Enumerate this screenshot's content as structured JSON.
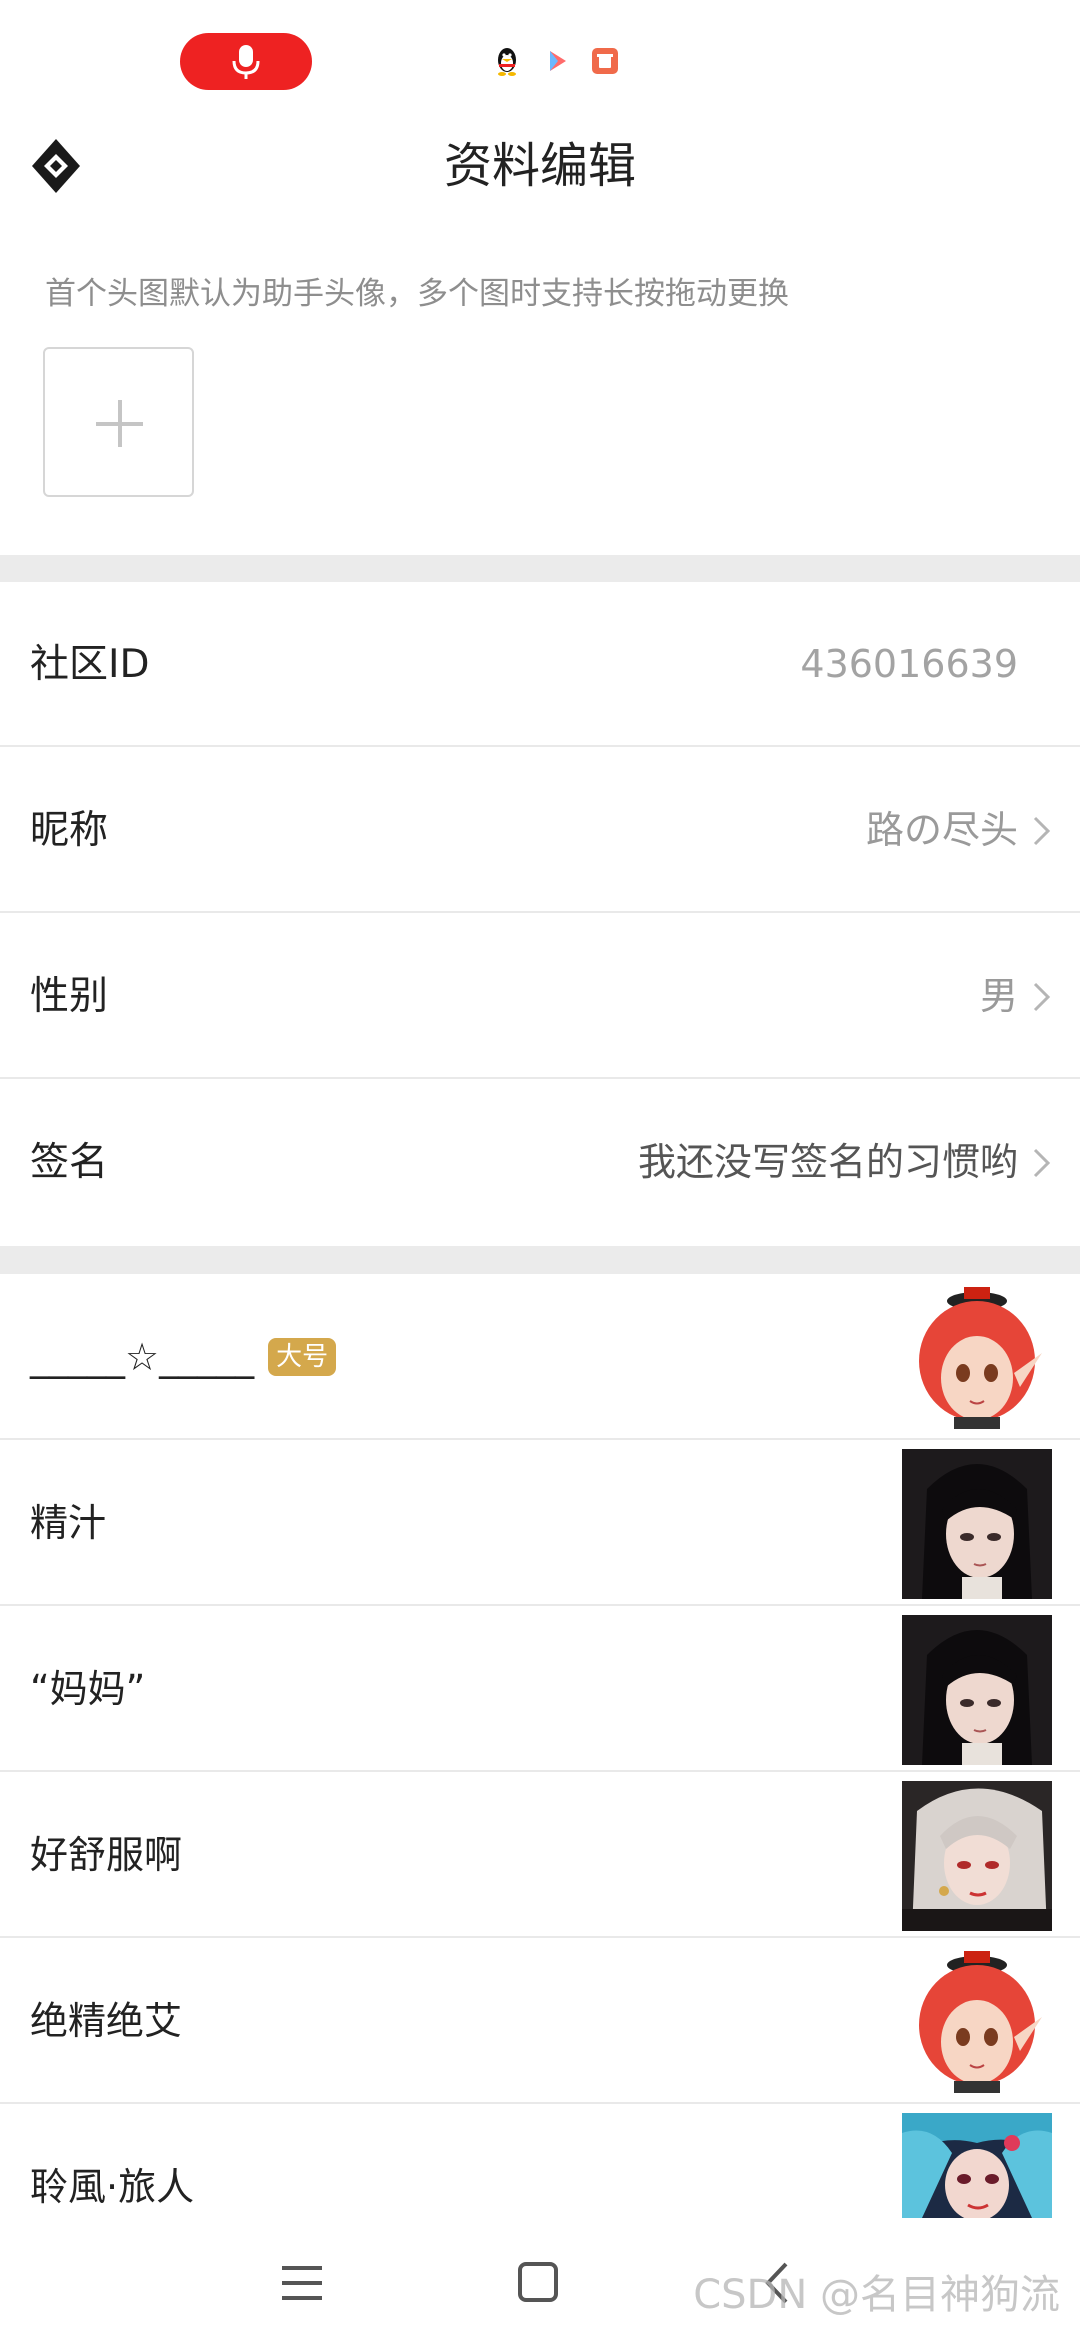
{
  "header": {
    "title": "资料编辑"
  },
  "avatar_section": {
    "hint": "首个头图默认为助手头像，多个图时支持长按拖动更换"
  },
  "profile": {
    "community_id_label": "社区ID",
    "community_id_value": "436016639",
    "nickname_label": "昵称",
    "nickname_value": "路の尽头",
    "gender_label": "性别",
    "gender_value": "男",
    "signature_label": "签名",
    "signature_value": "我还没写签名的习惯哟"
  },
  "accounts": [
    {
      "name": "_____☆_____",
      "badge": "大号",
      "avatar": "red-haired-character"
    },
    {
      "name": "精汁",
      "avatar": "dark-haired-character"
    },
    {
      "name": "“妈妈”",
      "avatar": "dark-haired-character"
    },
    {
      "name": "好舒服啊",
      "avatar": "white-haired-character"
    },
    {
      "name": "绝精绝艾",
      "avatar": "red-haired-character"
    },
    {
      "name": "聆風·旅人",
      "avatar": "blue-haired-character"
    }
  ],
  "watermark": "CSDN @名目神狗流",
  "colors": {
    "accent_red": "#ee2222",
    "badge_gold": "#d4a84c",
    "divider": "#ebebeb"
  }
}
